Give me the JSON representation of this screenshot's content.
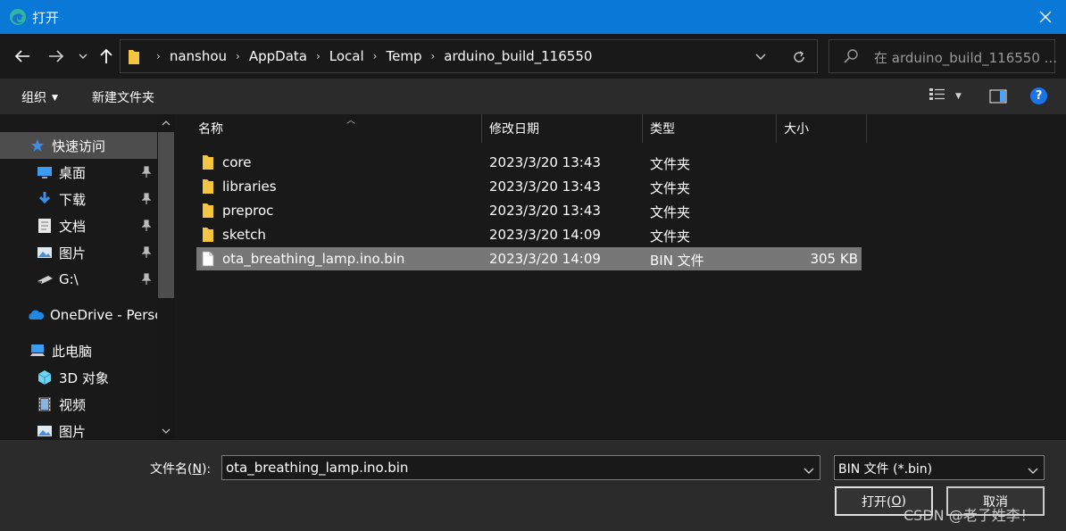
{
  "window": {
    "title": "打开",
    "title_bar_color": "#0a78d6",
    "app_icon": "edge-browser-icon",
    "close_icon": "close-icon"
  },
  "nav": {
    "back_icon": "arrow-left-icon",
    "forward_icon": "arrow-right-icon",
    "recent_icon": "chevron-down-icon",
    "up_icon": "arrow-up-icon"
  },
  "address": {
    "breadcrumbs": [
      "nanshou",
      "AppData",
      "Local",
      "Temp",
      "arduino_build_116550"
    ],
    "separator": "›",
    "refresh_icon": "refresh-icon"
  },
  "search": {
    "placeholder": "在 arduino_build_116550 ..."
  },
  "toolbar": {
    "organize_label": "组织",
    "new_folder_label": "新建文件夹",
    "help_label": "?"
  },
  "sidebar": {
    "items": [
      {
        "label": "快速访问",
        "icon": "star-icon",
        "selected": true,
        "pinned": false
      },
      {
        "label": "桌面",
        "icon": "desktop-icon",
        "selected": false,
        "pinned": true
      },
      {
        "label": "下载",
        "icon": "download-icon",
        "selected": false,
        "pinned": true
      },
      {
        "label": "文档",
        "icon": "document-icon",
        "selected": false,
        "pinned": true
      },
      {
        "label": "图片",
        "icon": "picture-icon",
        "selected": false,
        "pinned": true
      },
      {
        "label": "G:\\",
        "icon": "drive-icon",
        "selected": false,
        "pinned": true
      },
      {
        "label": "OneDrive - Persc",
        "icon": "cloud-icon",
        "selected": false,
        "pinned": false
      },
      {
        "label": "此电脑",
        "icon": "computer-icon",
        "selected": false,
        "pinned": false
      },
      {
        "label": "3D 对象",
        "icon": "cube-icon",
        "selected": false,
        "pinned": false
      },
      {
        "label": "视频",
        "icon": "video-icon",
        "selected": false,
        "pinned": false
      },
      {
        "label": "图片",
        "icon": "picture-icon",
        "selected": false,
        "pinned": false
      }
    ]
  },
  "table": {
    "columns": [
      "名称",
      "修改日期",
      "类型",
      "大小"
    ],
    "rows": [
      {
        "name": "core",
        "date": "2023/3/20 13:43",
        "type": "文件夹",
        "size": "",
        "kind": "folder"
      },
      {
        "name": "libraries",
        "date": "2023/3/20 13:43",
        "type": "文件夹",
        "size": "",
        "kind": "folder"
      },
      {
        "name": "preproc",
        "date": "2023/3/20 13:43",
        "type": "文件夹",
        "size": "",
        "kind": "folder"
      },
      {
        "name": "sketch",
        "date": "2023/3/20 14:09",
        "type": "文件夹",
        "size": "",
        "kind": "folder"
      },
      {
        "name": "ota_breathing_lamp.ino.bin",
        "date": "2023/3/20 14:09",
        "type": "BIN 文件",
        "size": "305 KB",
        "kind": "file",
        "selected": true
      }
    ]
  },
  "footer": {
    "filename_label_pre": "文件名(",
    "filename_label_key": "N",
    "filename_label_post": "):",
    "filename_value": "ota_breathing_lamp.ino.bin",
    "filetype_value": "BIN 文件 (*.bin)",
    "open_pre": "打开(",
    "open_key": "O",
    "open_post": ")",
    "cancel_label": "取消",
    "watermark": "CSDN @老子姓李！"
  }
}
